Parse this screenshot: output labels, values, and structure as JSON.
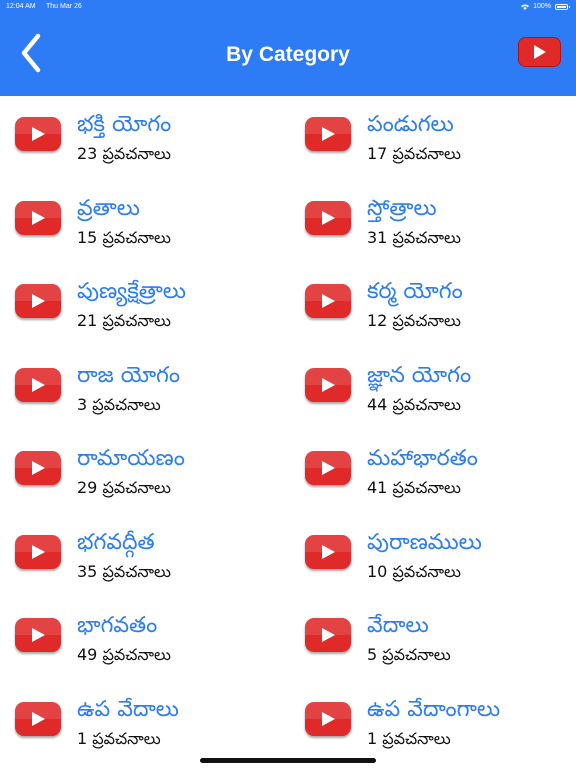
{
  "status_bar": {
    "time": "12:04 AM",
    "date": "Thu Mar 26",
    "battery": "100%",
    "battery_level": 1.0
  },
  "nav": {
    "title": "By Category",
    "back_icon": "chevron-left-icon",
    "right_icon": "youtube-icon"
  },
  "colors": {
    "nav_bg": "#2d7cf6",
    "title_blue": "#2e7cf2",
    "youtube_red": "#e02a2a"
  },
  "categories": [
    {
      "title": "భక్తి యోగం",
      "count": "23 ప్రవచనాలు"
    },
    {
      "title": "పండుగలు",
      "count": "17 ప్రవచనాలు"
    },
    {
      "title": "వ్రతాలు",
      "count": "15 ప్రవచనాలు"
    },
    {
      "title": "స్తోత్రాలు",
      "count": "31 ప్రవచనాలు"
    },
    {
      "title": "పుణ్యక్షేత్రాలు",
      "count": "21 ప్రవచనాలు"
    },
    {
      "title": "కర్మ యోగం",
      "count": "12 ప్రవచనాలు"
    },
    {
      "title": "రాజ యోగం",
      "count": "3 ప్రవచనాలు"
    },
    {
      "title": "జ్ఞాన యోగం",
      "count": "44 ప్రవచనాలు"
    },
    {
      "title": "రామాయణం",
      "count": "29 ప్రవచనాలు"
    },
    {
      "title": "మహాభారతం",
      "count": "41 ప్రవచనాలు"
    },
    {
      "title": "భగవద్గీత",
      "count": "35 ప్రవచనాలు"
    },
    {
      "title": "పురాణములు",
      "count": "10 ప్రవచనాలు"
    },
    {
      "title": "భాగవతం",
      "count": "49 ప్రవచనాలు"
    },
    {
      "title": "వేదాలు",
      "count": "5 ప్రవచనాలు"
    },
    {
      "title": "ఉప వేదాలు",
      "count": "1 ప్రవచనాలు"
    },
    {
      "title": "ఉప వేదాంగాలు",
      "count": "1 ప్రవచనాలు"
    }
  ]
}
